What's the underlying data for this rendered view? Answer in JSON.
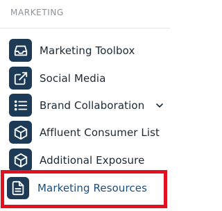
{
  "section": {
    "title": "MARKETING"
  },
  "menu": {
    "items": [
      {
        "label": "Marketing Toolbox",
        "icon": "inbox-tray-icon"
      },
      {
        "label": "Social Media",
        "icon": "external-link-icon"
      },
      {
        "label": "Brand Collaboration",
        "icon": "list-icon",
        "expandable": true
      },
      {
        "label": "Affluent Consumer List",
        "icon": "cube-icon"
      },
      {
        "label": "Additional Exposure",
        "icon": "cube-icon"
      },
      {
        "label": "Marketing Resources",
        "icon": "document-icon",
        "active": true
      }
    ]
  },
  "colors": {
    "icon_background": "#1d3a56",
    "highlight_border": "#e3111f",
    "active_text": "#1d4e7a",
    "section_title": "#8a929b"
  }
}
